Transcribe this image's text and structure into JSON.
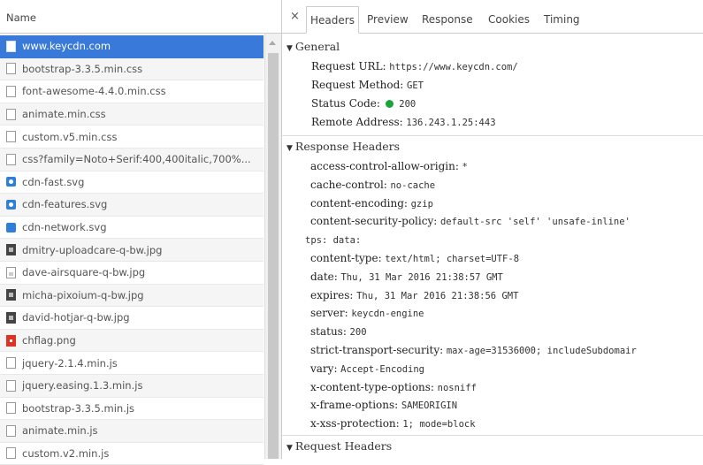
{
  "left_panel": {
    "header": "Name",
    "files": [
      {
        "name": "www.keycdn.com",
        "icon": "document-icon",
        "selected": true
      },
      {
        "name": "bootstrap-3.3.5.min.css",
        "icon": "document-icon"
      },
      {
        "name": "font-awesome-4.4.0.min.css",
        "icon": "document-icon"
      },
      {
        "name": "animate.min.css",
        "icon": "document-icon"
      },
      {
        "name": "custom.v5.min.css",
        "icon": "document-icon"
      },
      {
        "name": "css?family=Noto+Serif:400,400italic,700%...",
        "icon": "document-icon"
      },
      {
        "name": "cdn-fast.svg",
        "icon": "svg-image-icon"
      },
      {
        "name": "cdn-features.svg",
        "icon": "svg-image-icon"
      },
      {
        "name": "cdn-network.svg",
        "icon": "svg-image-icon"
      },
      {
        "name": "dmitry-uploadcare-q-bw.jpg",
        "icon": "photo-icon"
      },
      {
        "name": "dave-airsquare-q-bw.jpg",
        "icon": "photo-icon"
      },
      {
        "name": "micha-pixoium-q-bw.jpg",
        "icon": "photo-icon"
      },
      {
        "name": "david-hotjar-q-bw.jpg",
        "icon": "photo-icon"
      },
      {
        "name": "chflag.png",
        "icon": "flag-image-icon"
      },
      {
        "name": "jquery-2.1.4.min.js",
        "icon": "document-icon"
      },
      {
        "name": "jquery.easing.1.3.min.js",
        "icon": "document-icon"
      },
      {
        "name": "bootstrap-3.3.5.min.js",
        "icon": "document-icon"
      },
      {
        "name": "animate.min.js",
        "icon": "document-icon"
      },
      {
        "name": "custom.v2.min.js",
        "icon": "document-icon"
      }
    ]
  },
  "tabs": {
    "close": "×",
    "headers": "Headers",
    "preview": "Preview",
    "response": "Response",
    "cookies": "Cookies",
    "timing": "Timing"
  },
  "general": {
    "title": "General",
    "request_url_label": "Request URL:",
    "request_url": "https://www.keycdn.com/",
    "request_method_label": "Request Method:",
    "request_method": "GET",
    "status_code_label": "Status Code:",
    "status_code": "200",
    "remote_address_label": "Remote Address:",
    "remote_address": "136.243.1.25:443"
  },
  "response_headers": {
    "title": "Response Headers",
    "items": [
      {
        "key": "access-control-allow-origin:",
        "value": "*"
      },
      {
        "key": "cache-control:",
        "value": "no-cache"
      },
      {
        "key": "content-encoding:",
        "value": "gzip"
      },
      {
        "key": "content-security-policy:",
        "value": "default-src 'self' 'unsafe-inline'"
      },
      {
        "key": "",
        "value": "tps: data:"
      },
      {
        "key": "content-type:",
        "value": "text/html; charset=UTF-8"
      },
      {
        "key": "date:",
        "value": "Thu, 31 Mar 2016 21:38:57 GMT"
      },
      {
        "key": "expires:",
        "value": "Thu, 31 Mar 2016 21:38:56 GMT"
      },
      {
        "key": "server:",
        "value": "keycdn-engine"
      },
      {
        "key": "status:",
        "value": "200"
      },
      {
        "key": "strict-transport-security:",
        "value": "max-age=31536000; includeSubdomair"
      },
      {
        "key": "vary:",
        "value": "Accept-Encoding"
      },
      {
        "key": "x-content-type-options:",
        "value": "nosniff"
      },
      {
        "key": "x-frame-options:",
        "value": "SAMEORIGIN"
      },
      {
        "key": "x-xss-protection:",
        "value": "1; mode=block"
      }
    ]
  },
  "request_headers": {
    "title": "Request Headers"
  },
  "colors": {
    "selected_row": "#3879d9",
    "status_ok": "#1aa33a"
  }
}
